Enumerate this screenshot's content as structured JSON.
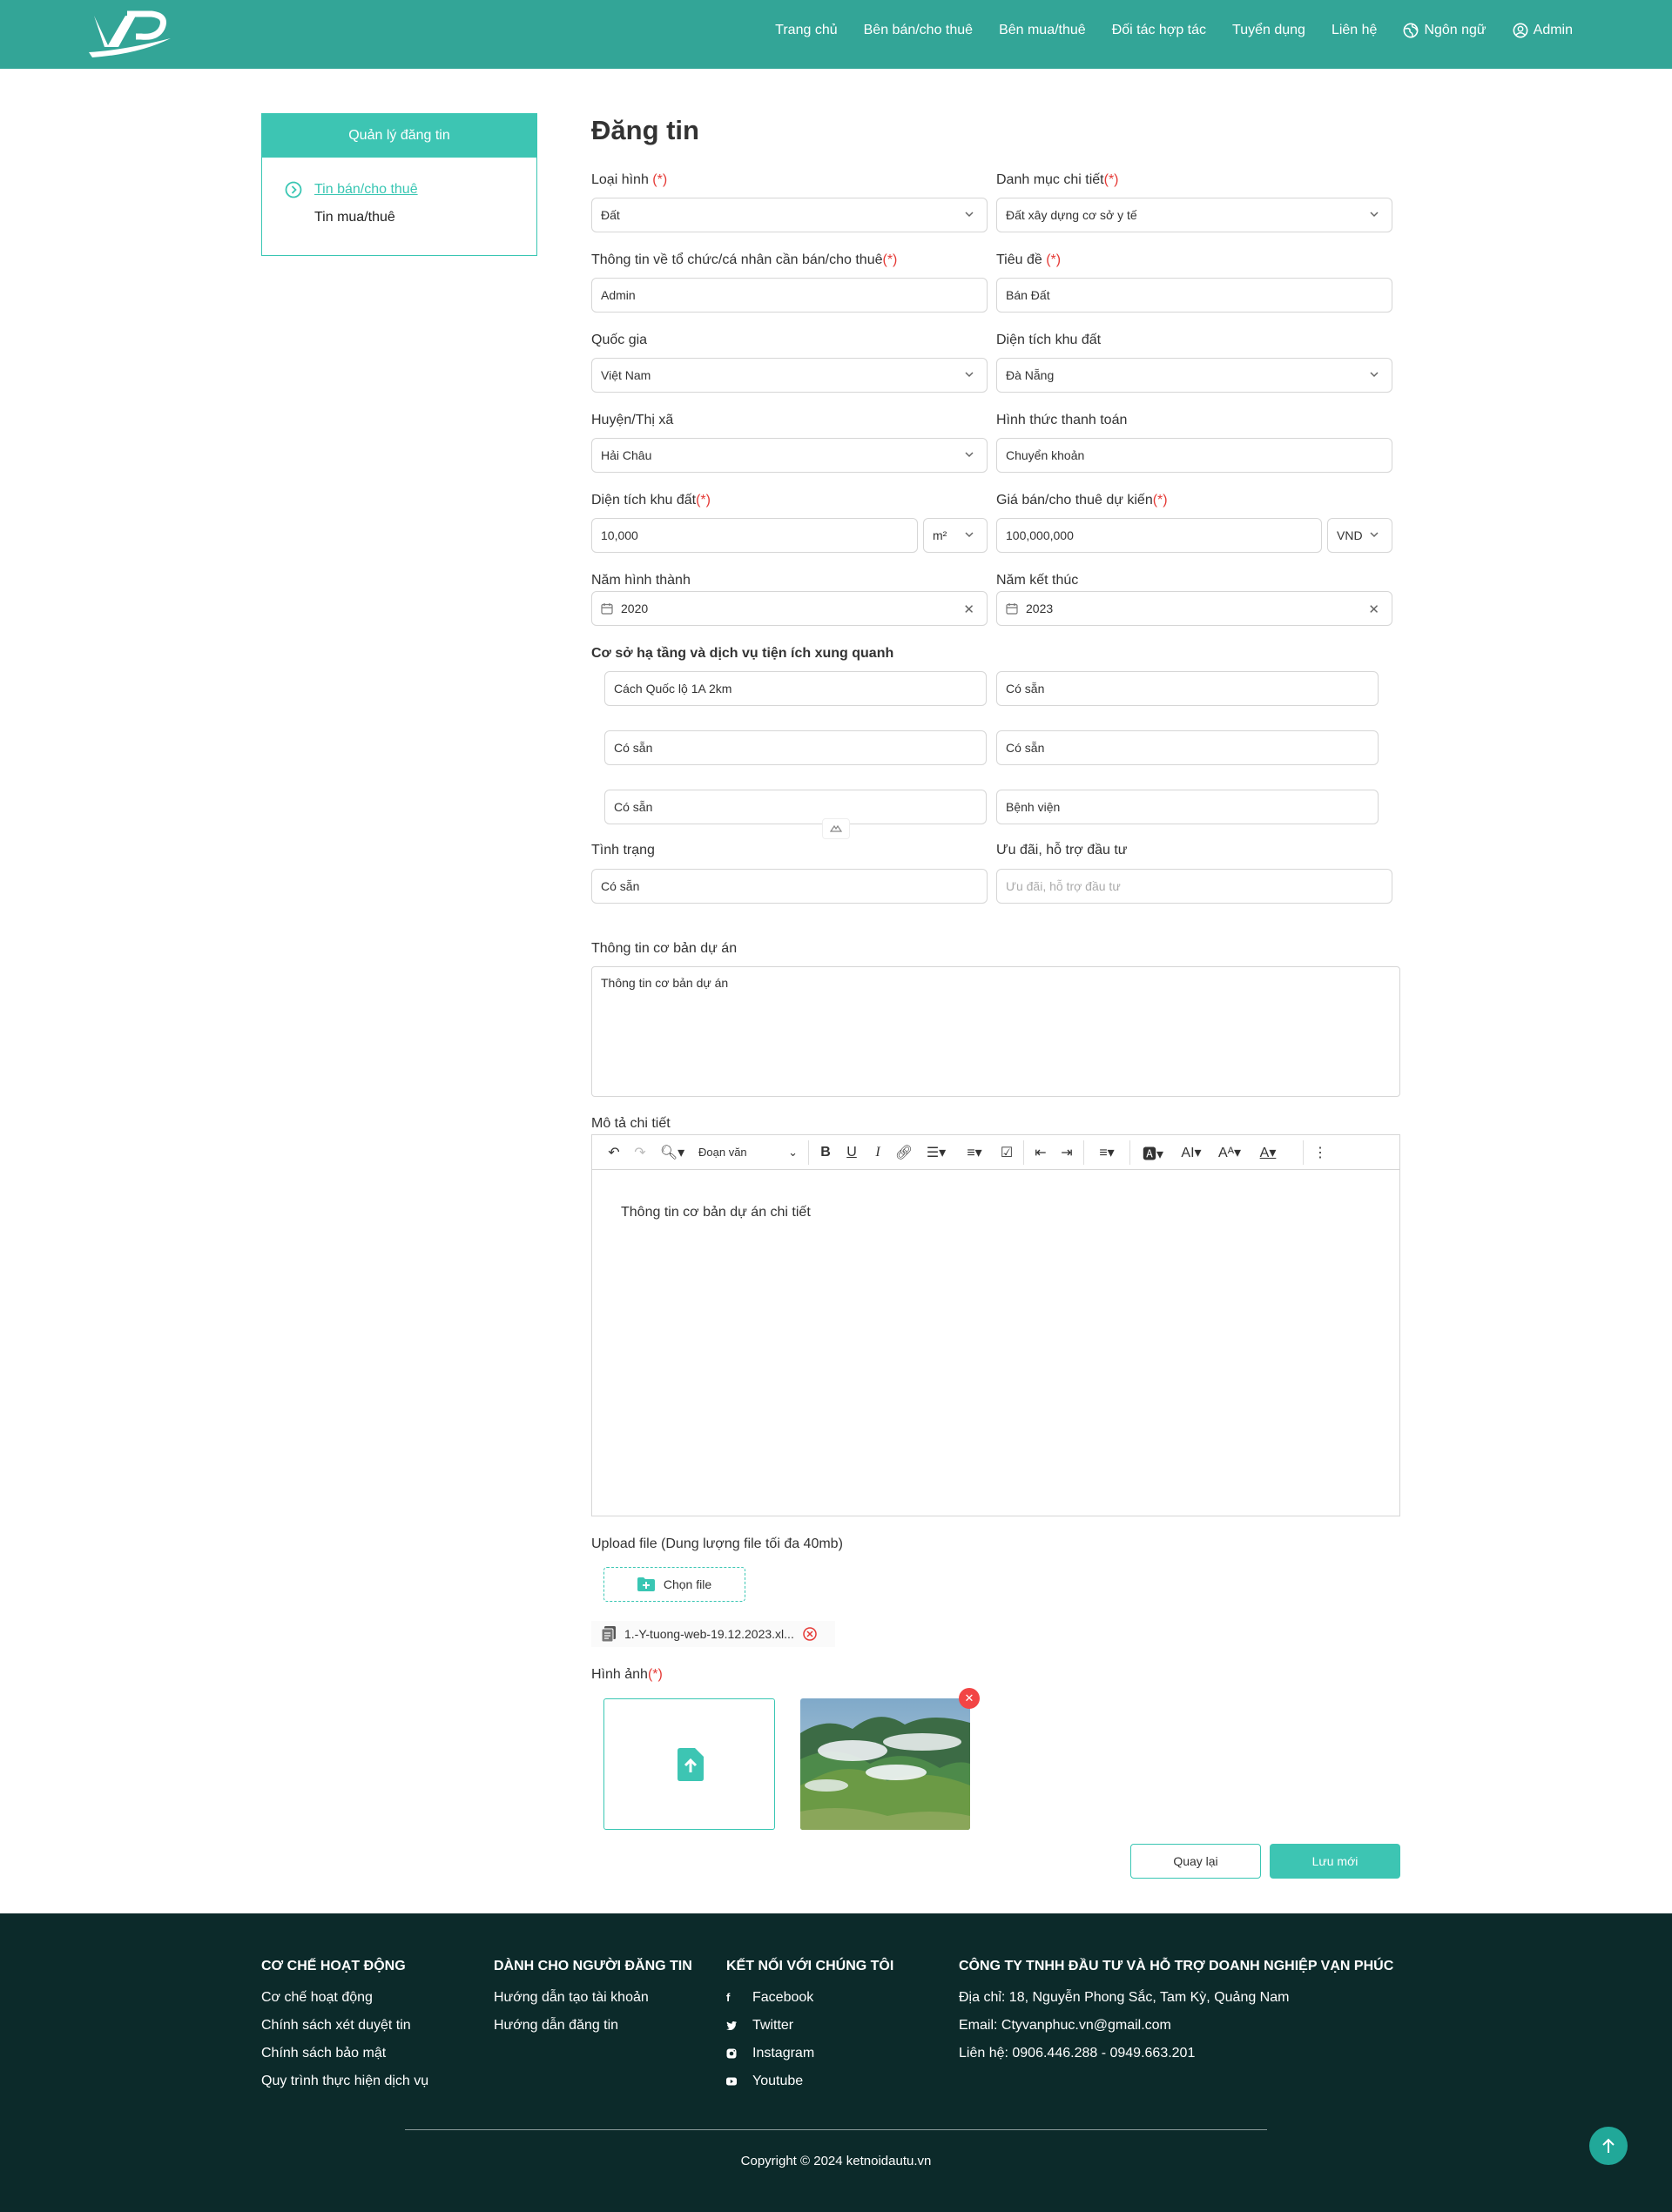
{
  "header": {
    "nav": [
      "Trang chủ",
      "Bên bán/cho thuê",
      "Bên mua/thuê",
      "Đối tác hợp tác",
      "Tuyển dụng",
      "Liên hệ"
    ],
    "language": "Ngôn ngữ",
    "user": "Admin",
    "colors": {
      "header_bg": "#33a597",
      "accent": "#3dc5b3",
      "footer_bg": "#0c2a2a"
    }
  },
  "sidebar": {
    "title": "Quản lý đăng tin",
    "items": [
      "Tin bán/cho thuê",
      "Tin mua/thuê"
    ]
  },
  "form": {
    "title": "Đăng tin",
    "required_mark": "(*)",
    "loai_hinh": {
      "label": "Loại hình ",
      "value": "Đất"
    },
    "danh_muc": {
      "label": "Danh mục chi tiết",
      "value": "Đất xây dựng cơ sở y tế"
    },
    "thong_tin_to_chuc": {
      "label": "Thông tin về tổ chức/cá nhân cần bán/cho thuê",
      "value": "Admin"
    },
    "tieu_de": {
      "label": "Tiêu đề ",
      "value": "Bán Đất"
    },
    "quoc_gia": {
      "label": "Quốc gia",
      "value": "Việt Nam"
    },
    "dien_tich_khu_dat_select": {
      "label": "Diện tích khu đất",
      "value": "Đà Nẵng"
    },
    "huyen": {
      "label": "Huyện/Thị xã",
      "value": "Hải Châu"
    },
    "hinh_thuc_thanh_toan": {
      "label": "Hình thức thanh toán",
      "value": "Chuyển khoản"
    },
    "dien_tich": {
      "label": "Diện tích khu đất",
      "value": "10,000",
      "unit": "m²"
    },
    "gia_ban": {
      "label": "Giá bán/cho thuê dự kiến",
      "value": "100,000,000",
      "currency": "VND"
    },
    "nam_hinh_thanh": {
      "label": "Năm hình thành",
      "value": "2020"
    },
    "nam_ket_thuc": {
      "label": "Năm kết thúc",
      "value": "2023"
    },
    "co_so_ha_tang": {
      "label": "Cơ sở hạ tầng và dịch vụ tiện ích xung quanh",
      "values": [
        "Cách Quốc lộ 1A 2km",
        "Có sẵn",
        "Có sẵn",
        "Có sẵn",
        "Có sẵn",
        "Bệnh viện"
      ]
    },
    "tinh_trang": {
      "label": "Tình trạng",
      "value": "Có sẵn"
    },
    "uu_dai": {
      "label": "Ưu đãi, hỗ trợ đầu tư",
      "placeholder": "Ưu đãi, hỗ trợ đầu tư"
    },
    "thong_tin_co_ban": {
      "label": "Thông tin cơ bản dự án",
      "value": "Thông tin cơ bản dự án"
    },
    "mo_ta": {
      "label": "Mô tả chi tiết",
      "paragraph_style": "Đoạn văn",
      "content": "Thông tin cơ bản dự án chi tiết"
    },
    "upload": {
      "label": "Upload file (Dung lượng file tối đa 40mb)",
      "button": "Chọn file",
      "file_name": "1.-Y-tuong-web-19.12.2023.xl..."
    },
    "hinh_anh": {
      "label": "Hình ảnh"
    },
    "back_button": "Quay lại",
    "save_button": "Lưu mới"
  },
  "footer": {
    "col1": {
      "title": "Cơ chế hoạt động",
      "links": [
        "Cơ chế hoạt động",
        "Chính sách xét duyệt tin",
        "Chính sách bảo mật",
        "Quy trình thực hiện dịch vụ"
      ]
    },
    "col2": {
      "title": "Dành cho người đăng tin",
      "links": [
        "Hướng dẫn tạo tài khoản",
        "Hướng dẫn đăng tin"
      ]
    },
    "col3": {
      "title": "Kết nối với chúng tôi",
      "links": [
        "Facebook",
        "Twitter",
        "Instagram",
        "Youtube"
      ]
    },
    "col4": {
      "title": "Công ty TNHH đầu tư và hỗ trợ doanh nghiệp Vạn Phúc",
      "lines": [
        "Địa chỉ: 18, Nguyễn Phong Sắc, Tam Kỳ, Quảng Nam",
        "Email: Ctyvanphuc.vn@gmail.com",
        "Liên hệ: 0906.446.288 - 0949.663.201"
      ]
    },
    "copyright": "Copyright © 2024 ketnoidautu.vn"
  }
}
